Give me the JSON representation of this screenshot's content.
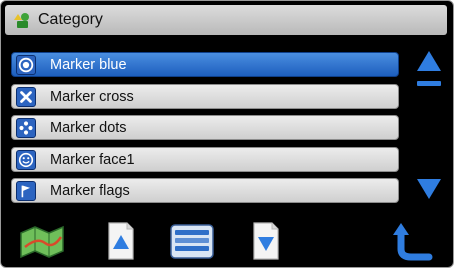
{
  "header": {
    "title": "Category",
    "icon": "category-icon"
  },
  "list": {
    "items": [
      {
        "label": "Marker blue",
        "icon": "target-marker-icon",
        "selected": true
      },
      {
        "label": "Marker cross",
        "icon": "cross-marker-icon",
        "selected": false
      },
      {
        "label": "Marker dots",
        "icon": "dots-marker-icon",
        "selected": false
      },
      {
        "label": "Marker face1",
        "icon": "face-marker-icon",
        "selected": false
      },
      {
        "label": "Marker flags",
        "icon": "flag-marker-icon",
        "selected": false
      }
    ]
  },
  "scroll": {
    "up_icon": "scroll-up-icon",
    "down_icon": "scroll-down-icon"
  },
  "toolbar": {
    "buttons": [
      {
        "name": "map-button",
        "icon": "map-icon"
      },
      {
        "name": "page-up-button",
        "icon": "page-up-icon"
      },
      {
        "name": "menu-button",
        "icon": "list-menu-icon"
      },
      {
        "name": "page-down-button",
        "icon": "page-down-icon"
      },
      {
        "name": "back-button",
        "icon": "back-arrow-icon"
      }
    ]
  },
  "colors": {
    "selected": "#1d5fbe",
    "accent": "#2f7de0",
    "background": "#000000"
  }
}
